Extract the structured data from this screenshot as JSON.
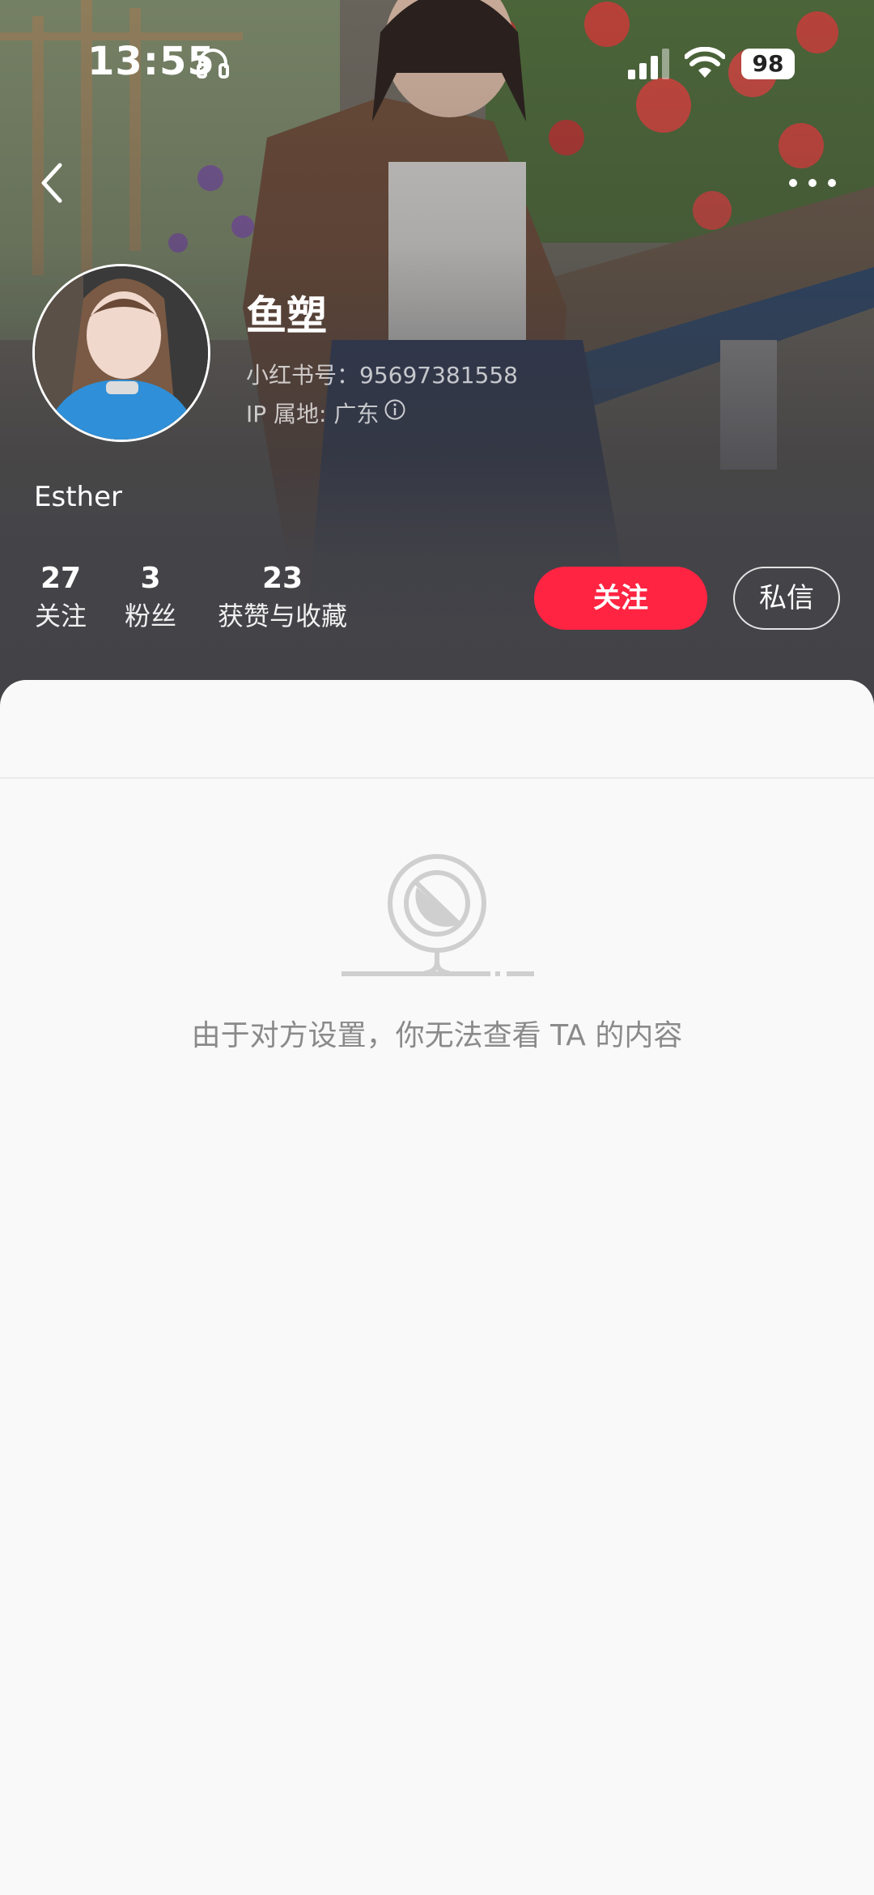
{
  "status_bar": {
    "time": "13:55",
    "battery": "98"
  },
  "nav": {
    "back_icon": "chevron-left-icon",
    "more_icon": "more-horizontal-icon"
  },
  "profile": {
    "name": "鱼塑",
    "red_id": "小红书号：95697381558",
    "ip_location": "IP 属地: 广东",
    "bio": "Esther"
  },
  "stats": [
    {
      "value": "27",
      "label": "关注"
    },
    {
      "value": "3",
      "label": "粉丝"
    },
    {
      "value": "23",
      "label": "获赞与收藏"
    }
  ],
  "actions": {
    "follow_label": "关注",
    "message_label": "私信"
  },
  "content": {
    "blocked_icon": "prohibited-icon",
    "blocked_message": "由于对方设置，你无法查看 TA 的内容"
  },
  "colors": {
    "accent": "#ff2442",
    "panel_bg": "#f9f9f9",
    "muted_text": "#8a8a8a"
  }
}
